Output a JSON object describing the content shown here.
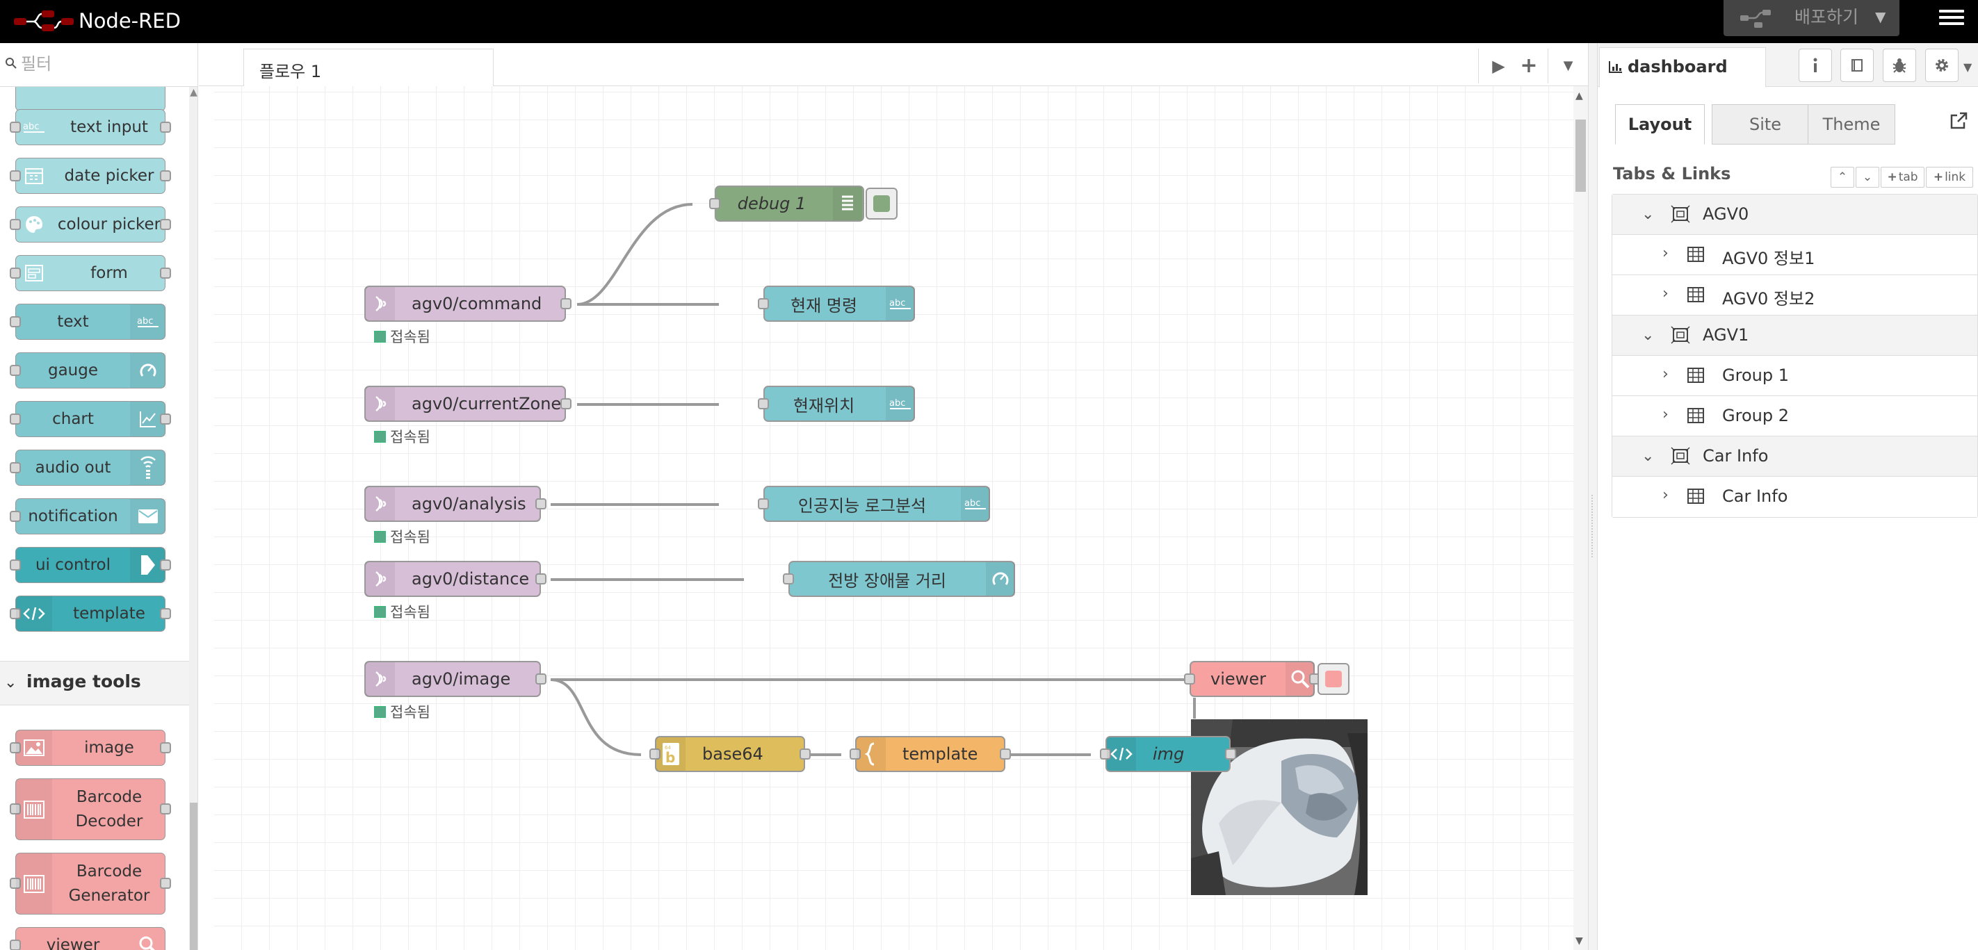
{
  "app": {
    "title": "Node-RED"
  },
  "header": {
    "deploy_label": "배포하기"
  },
  "palette": {
    "filter_placeholder": "필터",
    "nodes": [
      {
        "label": "text input",
        "icon": "abc-icon"
      },
      {
        "label": "date picker",
        "icon": "calendar-icon"
      },
      {
        "label": "colour picker",
        "icon": "palette-icon"
      },
      {
        "label": "form",
        "icon": "form-icon"
      },
      {
        "label": "text",
        "icon": "abc-icon"
      },
      {
        "label": "gauge",
        "icon": "gauge-icon"
      },
      {
        "label": "chart",
        "icon": "chart-icon"
      },
      {
        "label": "audio out",
        "icon": "audio-icon"
      },
      {
        "label": "notification",
        "icon": "envelope-icon"
      },
      {
        "label": "ui control",
        "icon": "arrow-icon"
      },
      {
        "label": "template",
        "icon": "code-icon"
      }
    ],
    "category_image_tools": "image tools",
    "image_nodes": [
      {
        "label": "image",
        "icon": "image-icon"
      },
      {
        "label_line1": "Barcode",
        "label_line2": "Decoder",
        "icon": "barcode-icon"
      },
      {
        "label_line1": "Barcode",
        "label_line2": "Generator",
        "icon": "barcode-icon"
      },
      {
        "label": "viewer",
        "icon": "search-icon"
      }
    ]
  },
  "workspace": {
    "tab_label": "플로우 1",
    "nodes": {
      "debug": "debug 1",
      "mqtt_command": "agv0/command",
      "mqtt_zone": "agv0/currentZone",
      "mqtt_analysis": "agv0/analysis",
      "mqtt_distance": "agv0/distance",
      "mqtt_image": "agv0/image",
      "text_command": "현재 명령",
      "text_zone": "현재위치",
      "text_analysis": "인공지능 로그분석",
      "gauge_distance": "전방 장애물 거리",
      "viewer": "viewer",
      "base64": "base64",
      "template": "template",
      "img": "img"
    },
    "status_connected": "접속됨"
  },
  "sidebar": {
    "tab_label": "dashboard",
    "subtabs": [
      "Layout",
      "Site",
      "Theme"
    ],
    "section_title": "Tabs & Links",
    "btn_tab": "tab",
    "btn_link": "link",
    "tree": [
      {
        "type": "tab",
        "label": "AGV0"
      },
      {
        "type": "group",
        "label": "AGV0 정보1"
      },
      {
        "type": "group",
        "label": "AGV0 정보2"
      },
      {
        "type": "tab",
        "label": "AGV1"
      },
      {
        "type": "group",
        "label": "Group 1"
      },
      {
        "type": "group",
        "label": "Group 2"
      },
      {
        "type": "tab",
        "label": "Car Info"
      },
      {
        "type": "group",
        "label": "Car Info"
      }
    ]
  },
  "colors": {
    "header": "#000000",
    "mqtt": "#d8bfd8",
    "dashboard_ui": "#7fc7cf",
    "debug": "#87a980",
    "image_tools": "#f8a1a1"
  }
}
